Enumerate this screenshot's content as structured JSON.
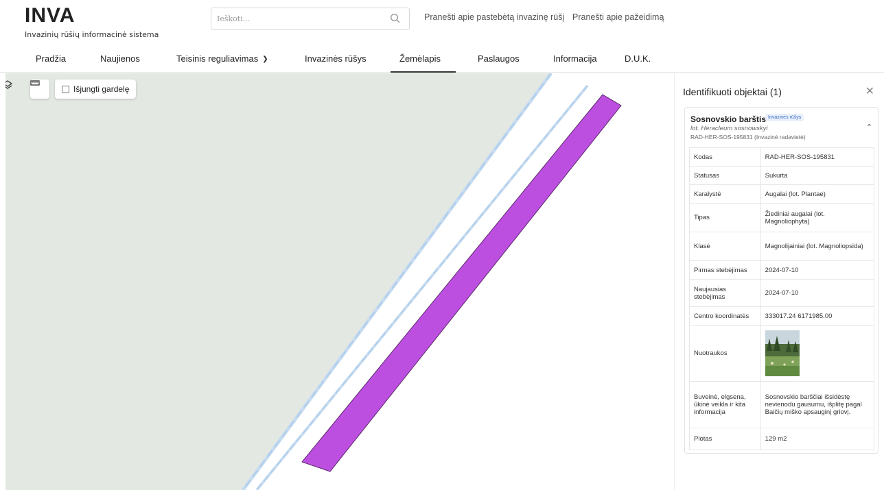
{
  "header": {
    "logo": "INVA",
    "subtitle": "Invazinių rūšių informacinė sistema",
    "search_placeholder": "Ieškoti...",
    "links": [
      "Pranešti apie pastebėtą invazinę rūšį",
      "Pranešti apie pažeidimą"
    ]
  },
  "nav": {
    "items": [
      {
        "label": "Pradžia"
      },
      {
        "label": "Naujienos"
      },
      {
        "label": "Teisinis reguliavimas"
      },
      {
        "label": "Invazinės rūšys"
      },
      {
        "label": "Žemėlapis",
        "active": true
      },
      {
        "label": "Paslaugos"
      },
      {
        "label": "Informacija"
      },
      {
        "label": "D.U.K."
      }
    ]
  },
  "map": {
    "grid_toggle_label": "Išjungti gardelę",
    "grid_disabled": false,
    "colors": {
      "land": "#e3e8e2",
      "river": "#b8d4ee",
      "polygon_fill": "#bd4fe0",
      "polygon_stroke": "#5a2a6a"
    },
    "icons": [
      "layers-icon",
      "ruler-icon"
    ]
  },
  "panel": {
    "title": "Identifikuoti objektai (1)",
    "close_icon": "close-icon",
    "object": {
      "name": "Sosnovskio barštis",
      "badge": "Invazinės rūšys",
      "latin": "lot. Heracleum sosnowskyi",
      "code_line": "RAD-HER-SOS-195831 (Invazinė radavietė)",
      "rows": [
        {
          "key": "Kodas",
          "value": "RAD-HER-SOS-195831"
        },
        {
          "key": "Statusas",
          "value": "Sukurta"
        },
        {
          "key": "Karalystė",
          "value": "Augalai (lot. Plantae)"
        },
        {
          "key": "Tipas",
          "value": "Žiediniai augalai (lot. Magnoliophyta)"
        },
        {
          "key": "Klasė",
          "value": "Magnolijainiai (lot. Magnoliopsida)"
        },
        {
          "key": "Pirmas stebėjimas",
          "value": "2024-07-10"
        },
        {
          "key": "Naujausias stebėjimas",
          "value": "2024-07-10"
        },
        {
          "key": "Centro koordinatės",
          "value": "333017.24 6171985.00"
        },
        {
          "key": "Nuotraukos",
          "value": ""
        },
        {
          "key": "Buveinė, elgsena, ūkinė veikla ir kita informacija",
          "value": "Sosnovskio barščiai išsidėstę nevienodu gausumu, išplitę pagal Baičių miško apsauginį griovį."
        },
        {
          "key": "Plotas",
          "value": "129 m2"
        }
      ]
    }
  }
}
